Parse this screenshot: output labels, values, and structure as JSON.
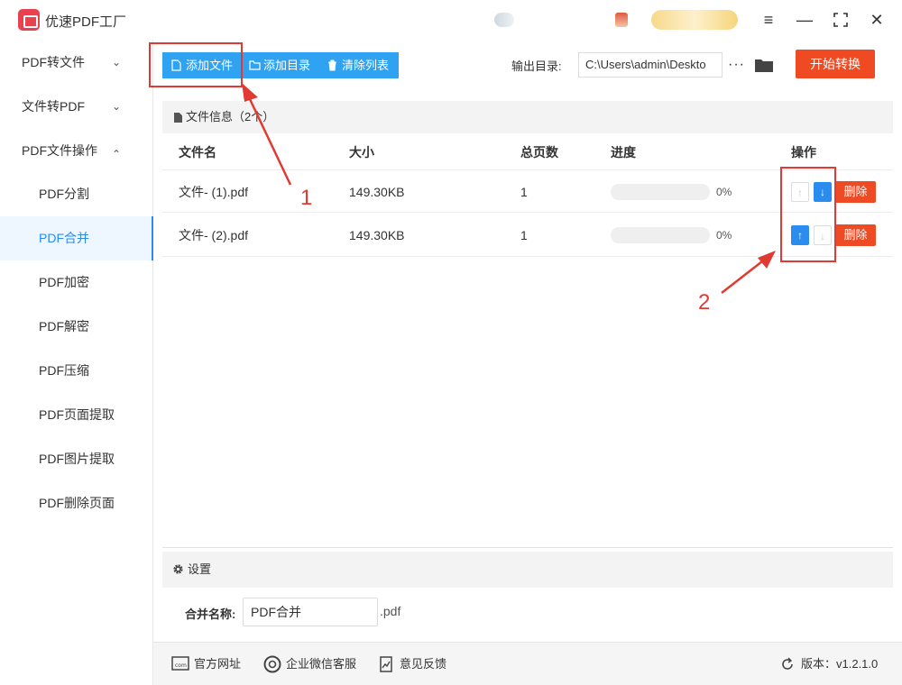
{
  "app": {
    "title": "优速PDF工厂"
  },
  "window": {
    "menu_icon": "hamburger-icon",
    "min_icon": "minimize-icon",
    "max_icon": "maximize-icon",
    "close_icon": "close-icon"
  },
  "sidebar": {
    "groups": [
      {
        "label": "PDF转文件",
        "chevron": "⌄"
      },
      {
        "label": "文件转PDF",
        "chevron": "⌄"
      },
      {
        "label": "PDF文件操作",
        "chevron": "⌃"
      }
    ],
    "items": [
      {
        "label": "PDF分割"
      },
      {
        "label": "PDF合并"
      },
      {
        "label": "PDF加密"
      },
      {
        "label": "PDF解密"
      },
      {
        "label": "PDF压缩"
      },
      {
        "label": "PDF页面提取"
      },
      {
        "label": "PDF图片提取"
      },
      {
        "label": "PDF删除页面"
      }
    ],
    "active_item": "PDF合并"
  },
  "toolbar": {
    "add_file": "添加文件",
    "add_folder": "添加目录",
    "clear_list": "清除列表",
    "output_label": "输出目录:",
    "output_path": "C:\\Users\\admin\\Deskto",
    "more": "···",
    "start": "开始转换"
  },
  "file_panel": {
    "title": "文件信息（2个）",
    "columns": [
      "文件名",
      "大小",
      "总页数",
      "进度",
      "操作"
    ],
    "rows": [
      {
        "name": "文件- (1).pdf",
        "size": "149.30KB",
        "pages": "1",
        "progress": "0%",
        "up_enabled": false,
        "down_enabled": true,
        "delete": "删除"
      },
      {
        "name": "文件- (2).pdf",
        "size": "149.30KB",
        "pages": "1",
        "progress": "0%",
        "up_enabled": true,
        "down_enabled": false,
        "delete": "删除"
      }
    ]
  },
  "settings": {
    "title": "设置",
    "merge_label": "合并名称:",
    "merge_value": "PDF合并",
    "merge_ext": ".pdf"
  },
  "footer": {
    "website": "官方网址",
    "wechat": "企业微信客服",
    "feedback": "意见反馈",
    "version": "版本：v1.2.1.0"
  },
  "annotations": {
    "label_1": "1",
    "label_2": "2"
  },
  "colors": {
    "primary": "#2b8cf0",
    "toolbar_blue": "#2fa3f2",
    "danger": "#f04a23",
    "annotation": "#e03a32"
  }
}
